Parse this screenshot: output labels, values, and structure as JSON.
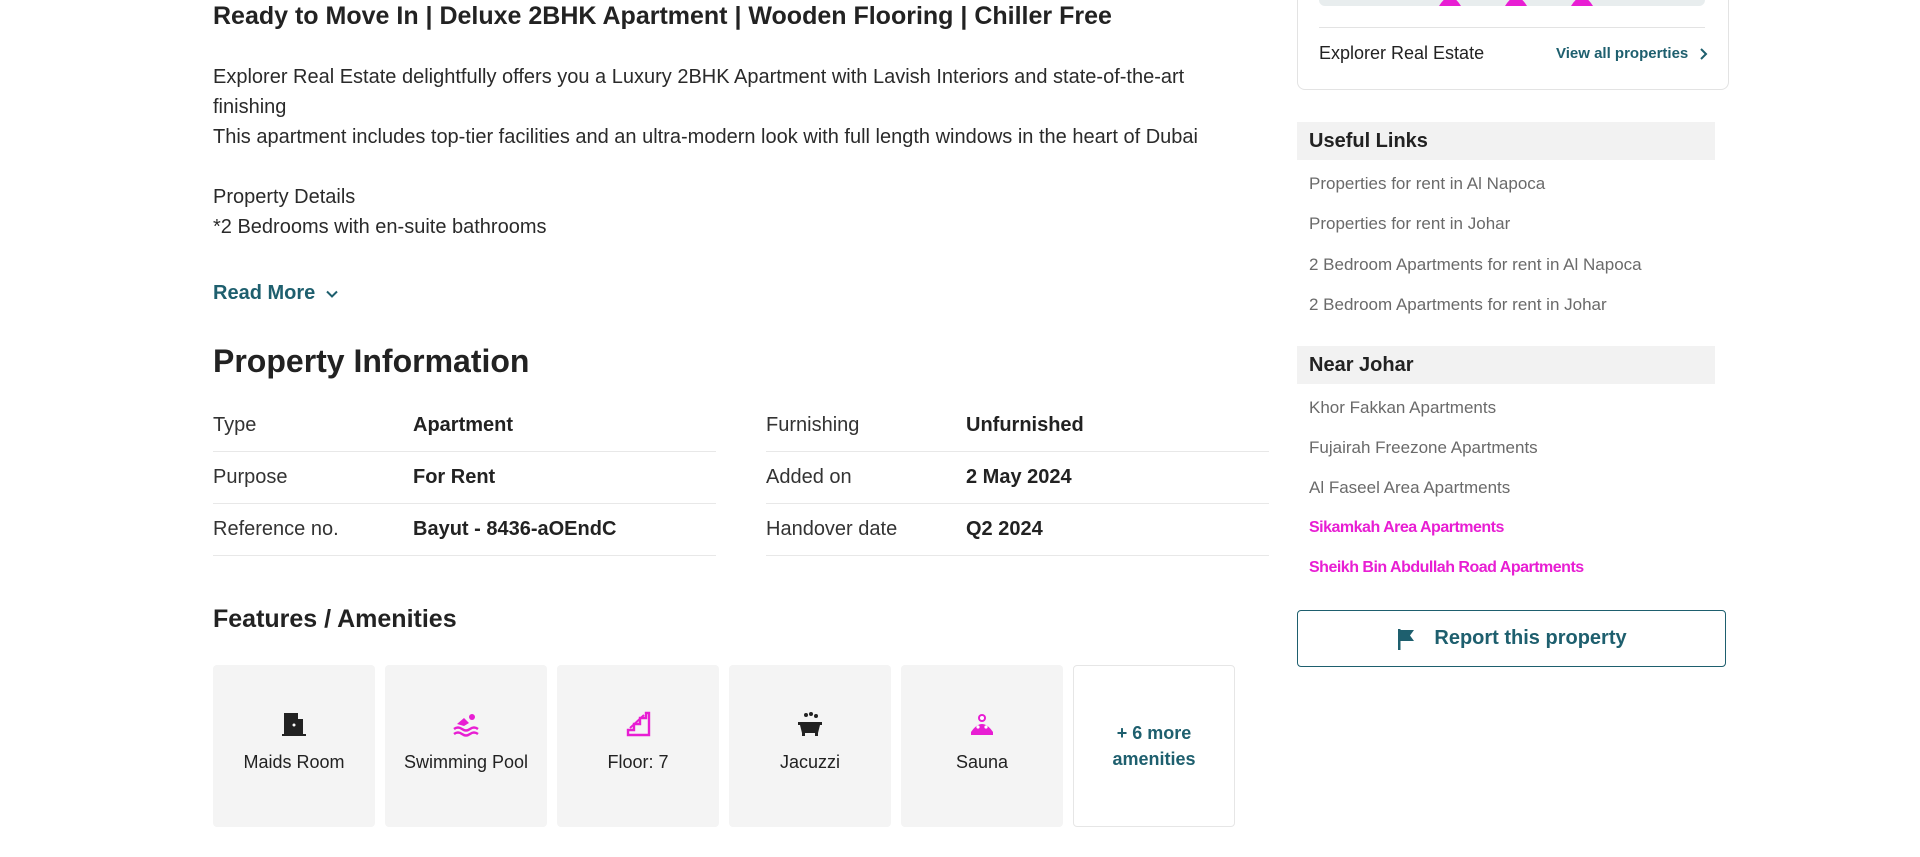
{
  "listing": {
    "headline": "Ready to Move In | Deluxe 2BHK Apartment | Wooden Flooring | Chiller Free",
    "description_lines": [
      "Explorer Real Estate delightfully offers you a Luxury 2BHK Apartment with Lavish Interiors and state-of-the-art finishing",
      "This apartment includes top-tier facilities and an ultra-modern look with full length windows in the heart of Dubai",
      "Property Details",
      "*2 Bedrooms with en-suite bathrooms"
    ],
    "read_more_label": "Read More"
  },
  "property_info": {
    "title": "Property Information",
    "left": [
      {
        "key": "Type",
        "value": "Apartment"
      },
      {
        "key": "Purpose",
        "value": "For Rent"
      },
      {
        "key": "Reference no.",
        "value": "Bayut - 8436-aOEndC"
      }
    ],
    "right": [
      {
        "key": "Furnishing",
        "value": "Unfurnished"
      },
      {
        "key": "Added on",
        "value": "2 May 2024"
      },
      {
        "key": "Handover date",
        "value": "Q2 2024"
      }
    ]
  },
  "amenities": {
    "title": "Features / Amenities",
    "items": [
      {
        "label": "Maids Room",
        "icon": "door-icon",
        "color": "#222222"
      },
      {
        "label": "Swimming Pool",
        "icon": "swimmer-icon",
        "color": "#e81ed3"
      },
      {
        "label": "Floor: 7",
        "icon": "stairs-icon",
        "color": "#e81ed3"
      },
      {
        "label": "Jacuzzi",
        "icon": "bathtub-icon",
        "color": "#222222"
      },
      {
        "label": "Sauna",
        "icon": "sauna-icon",
        "color": "#e81ed3"
      }
    ],
    "more_line1": "+ 6 more",
    "more_line2": "amenities"
  },
  "agent": {
    "name": "Explorer Real Estate",
    "view_all_label": "View all properties"
  },
  "useful_links": {
    "title": "Useful Links",
    "items": [
      "Properties for rent in Al Napoca",
      "Properties for rent in Johar",
      "2 Bedroom Apartments for rent in Al Napoca",
      "2 Bedroom Apartments for rent in Johar"
    ]
  },
  "near": {
    "title": "Near Johar",
    "items": [
      "Khor Fakkan Apartments",
      "Fujairah Freezone Apartments",
      "Al Faseel Area Apartments",
      "Sikamkah Area Apartments",
      "Sheikh Bin Abdullah Road Apartments"
    ]
  },
  "report_label": "Report this property",
  "colors": {
    "accent": "#1e5f6e",
    "highlight": "#e81ed3",
    "tile_bg": "#f4f4f4"
  }
}
